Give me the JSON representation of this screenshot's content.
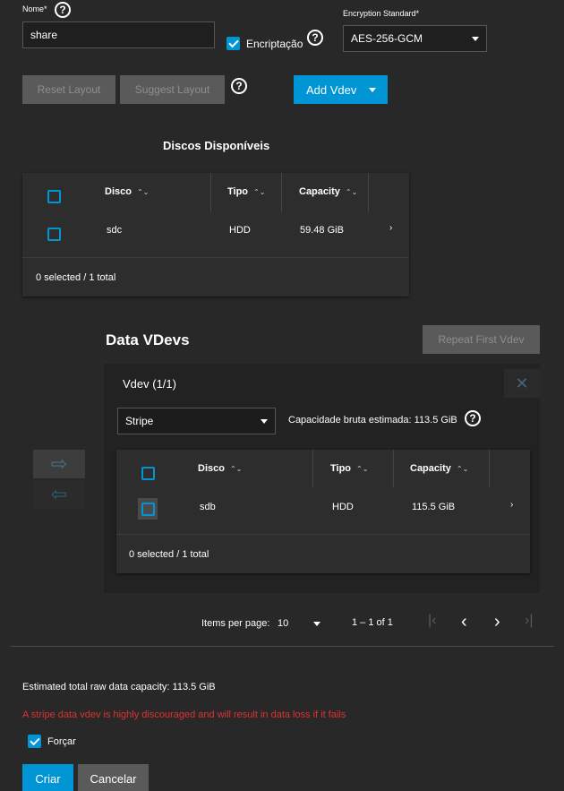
{
  "form": {
    "name_label": "Nome*",
    "name_value": "share",
    "encryption_label": "Encriptação",
    "encryption_standard_label": "Encryption Standard*",
    "encryption_standard_value": "AES-256-GCM"
  },
  "toolbar": {
    "reset_layout": "Reset Layout",
    "suggest_layout": "Suggest Layout",
    "add_vdev": "Add Vdev"
  },
  "available_disks": {
    "title": "Discos Disponíveis",
    "columns": [
      "Disco",
      "Tipo",
      "Capacity"
    ],
    "rows": [
      {
        "disk": "sdc",
        "type": "HDD",
        "capacity": "59.48 GiB"
      }
    ],
    "footer": "0 selected / 1 total"
  },
  "data_vdevs": {
    "title": "Data VDevs",
    "repeat_button": "Repeat First Vdev",
    "vdev_title": "Vdev (1/1)",
    "layout_value": "Stripe",
    "raw_capacity": "Capacidade bruta estimada: 113.5 GiB",
    "columns": [
      "Disco",
      "Tipo",
      "Capacity"
    ],
    "rows": [
      {
        "disk": "sdb",
        "type": "HDD",
        "capacity": "115.5 GiB"
      }
    ],
    "footer": "0 selected / 1 total"
  },
  "paginator": {
    "items_per_page_label": "Items per page:",
    "items_per_page_value": "10",
    "range": "1 – 1 of 1"
  },
  "summary": {
    "estimated_capacity": "Estimated total raw data capacity: 113.5 GiB",
    "warning": "A stripe data vdev is highly discouraged and will result in data loss if it fails",
    "force_label": "Forçar"
  },
  "actions": {
    "create": "Criar",
    "cancel": "Cancelar"
  },
  "colors": {
    "accent": "#0095d5",
    "warning": "#e03131",
    "background": "#282828"
  }
}
